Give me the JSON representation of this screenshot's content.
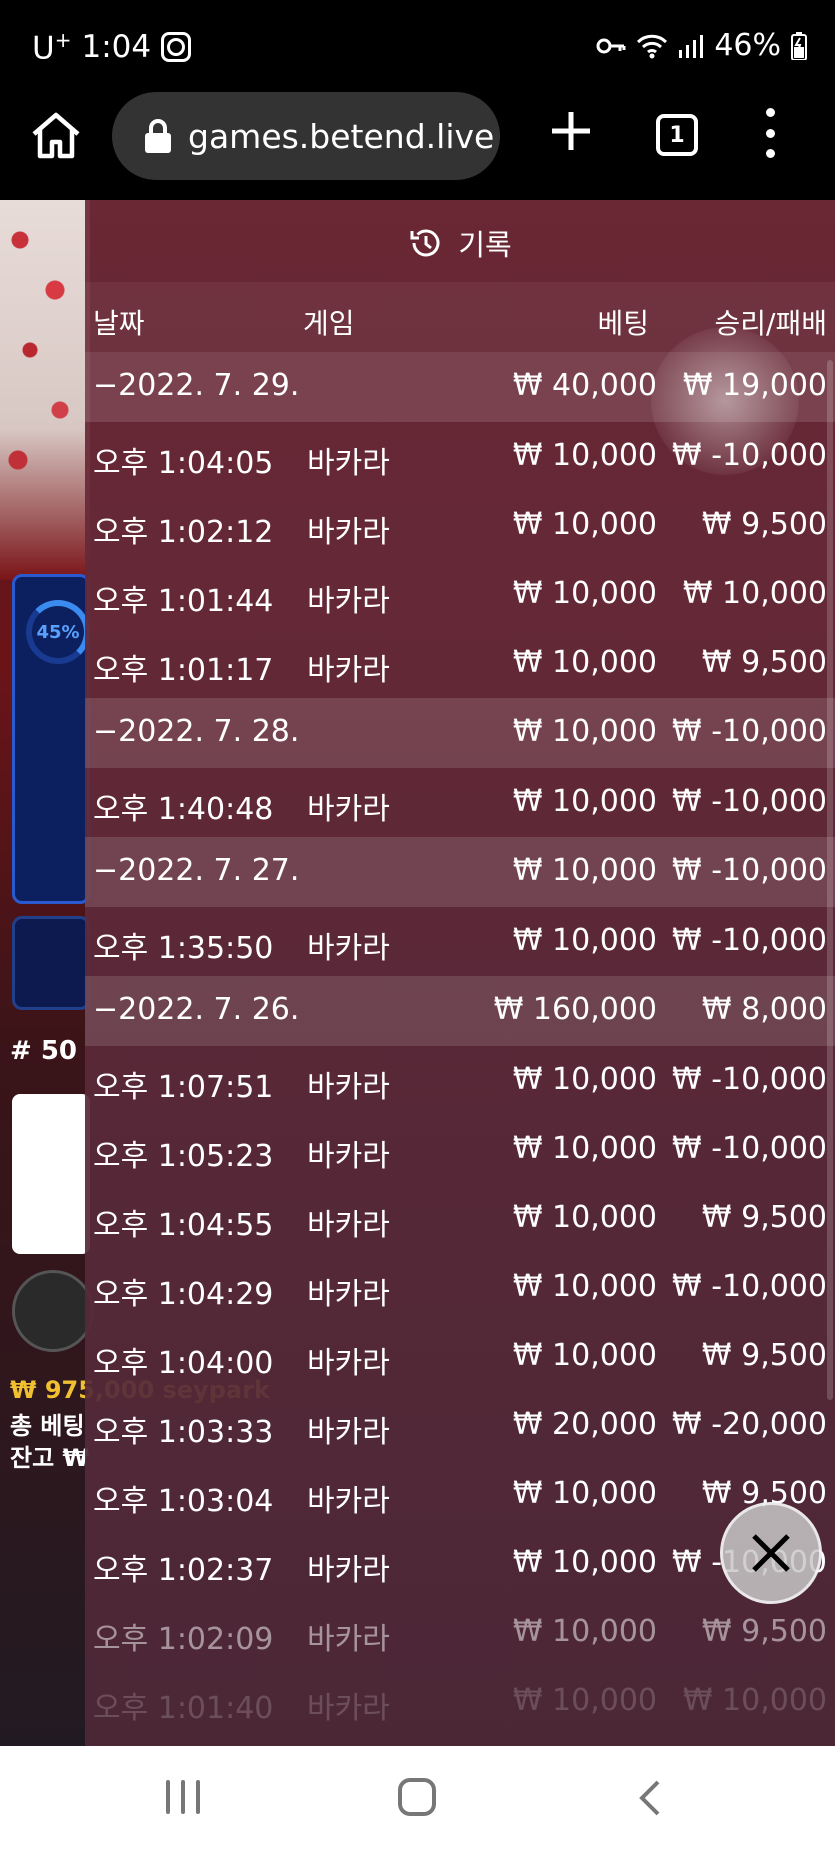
{
  "status_bar": {
    "carrier": "U",
    "carrier_sup": "+",
    "time": "1:04",
    "battery": "46%"
  },
  "browser": {
    "url": "games.betend.live",
    "tab_count": "1"
  },
  "game": {
    "progress_label": "45%",
    "round_label": "# 50",
    "balance_line_1": "₩ 975,000 seypark",
    "balance_line_2": "총 베팅",
    "balance_line_3": "잔고 ₩"
  },
  "history": {
    "title": "기록",
    "columns": {
      "date": "날짜",
      "game": "게임",
      "bet": "베팅",
      "result": "승리/패배"
    },
    "rows": [
      {
        "type": "day",
        "date": "−2022. 7. 29.",
        "game": "",
        "bet": "₩ 40,000",
        "result": "₩ 19,000"
      },
      {
        "type": "bet",
        "date": "오후 1:04:05",
        "game": "바카라",
        "bet": "₩ 10,000",
        "result": "₩ -10,000"
      },
      {
        "type": "bet",
        "date": "오후 1:02:12",
        "game": "바카라",
        "bet": "₩ 10,000",
        "result": "₩ 9,500"
      },
      {
        "type": "bet",
        "date": "오후 1:01:44",
        "game": "바카라",
        "bet": "₩ 10,000",
        "result": "₩ 10,000"
      },
      {
        "type": "bet",
        "date": "오후 1:01:17",
        "game": "바카라",
        "bet": "₩ 10,000",
        "result": "₩ 9,500"
      },
      {
        "type": "day",
        "date": "−2022. 7. 28.",
        "game": "",
        "bet": "₩ 10,000",
        "result": "₩ -10,000"
      },
      {
        "type": "bet",
        "date": "오후 1:40:48",
        "game": "바카라",
        "bet": "₩ 10,000",
        "result": "₩ -10,000"
      },
      {
        "type": "day",
        "date": "−2022. 7. 27.",
        "game": "",
        "bet": "₩ 10,000",
        "result": "₩ -10,000"
      },
      {
        "type": "bet",
        "date": "오후 1:35:50",
        "game": "바카라",
        "bet": "₩ 10,000",
        "result": "₩ -10,000"
      },
      {
        "type": "day",
        "date": "−2022. 7. 26.",
        "game": "",
        "bet": "₩ 160,000",
        "result": "₩ 8,000"
      },
      {
        "type": "bet",
        "date": "오후 1:07:51",
        "game": "바카라",
        "bet": "₩ 10,000",
        "result": "₩ -10,000"
      },
      {
        "type": "bet",
        "date": "오후 1:05:23",
        "game": "바카라",
        "bet": "₩ 10,000",
        "result": "₩ -10,000"
      },
      {
        "type": "bet",
        "date": "오후 1:04:55",
        "game": "바카라",
        "bet": "₩ 10,000",
        "result": "₩ 9,500"
      },
      {
        "type": "bet",
        "date": "오후 1:04:29",
        "game": "바카라",
        "bet": "₩ 10,000",
        "result": "₩ -10,000"
      },
      {
        "type": "bet",
        "date": "오후 1:04:00",
        "game": "바카라",
        "bet": "₩ 10,000",
        "result": "₩ 9,500"
      },
      {
        "type": "bet",
        "date": "오후 1:03:33",
        "game": "바카라",
        "bet": "₩ 20,000",
        "result": "₩ -20,000"
      },
      {
        "type": "bet",
        "date": "오후 1:03:04",
        "game": "바카라",
        "bet": "₩ 10,000",
        "result": "₩ 9,500"
      },
      {
        "type": "bet",
        "date": "오후 1:02:37",
        "game": "바카라",
        "bet": "₩ 10,000",
        "result": "₩ -10,000"
      },
      {
        "type": "bet",
        "date": "오후 1:02:09",
        "game": "바카라",
        "bet": "₩ 10,000",
        "result": "₩ 9,500"
      },
      {
        "type": "bet",
        "date": "오후 1:01:40",
        "game": "바카라",
        "bet": "₩ 10,000",
        "result": "₩ 10,000"
      }
    ]
  },
  "colors": {
    "overlay": "#6c2836",
    "day_row": "#8a4e5a",
    "accent_blue": "#3a8af0",
    "balance_gold": "#f0c030"
  },
  "icons": {
    "home": "home-icon",
    "lock": "lock-icon",
    "add_tab": "plus-icon",
    "menu": "more-vert-icon",
    "history": "history-icon",
    "close": "close-icon"
  }
}
